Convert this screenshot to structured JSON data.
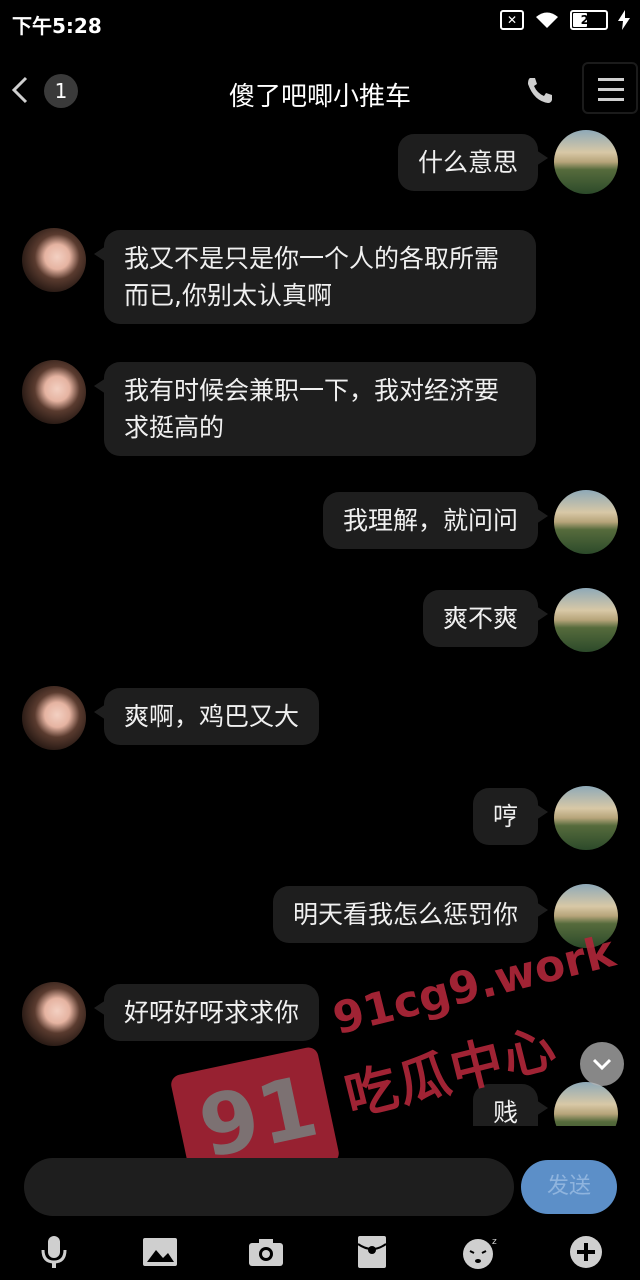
{
  "status_bar": {
    "time": "下午5:28",
    "sim": "✕",
    "battery": "21"
  },
  "header": {
    "badge_count": "1",
    "title": "傻了吧唧小推车"
  },
  "messages": [
    {
      "side": "right",
      "text": "什么意思"
    },
    {
      "side": "left",
      "text": "我又不是只是你一个人的各取所需而已,你别太认真啊"
    },
    {
      "side": "left",
      "text": "我有时候会兼职一下，我对经济要求挺高的"
    },
    {
      "side": "right",
      "text": "我理解，就问问"
    },
    {
      "side": "right",
      "text": "爽不爽"
    },
    {
      "side": "left",
      "text": "爽啊，鸡巴又大"
    },
    {
      "side": "right",
      "text": "哼"
    },
    {
      "side": "right",
      "text": "明天看我怎么惩罚你"
    },
    {
      "side": "left",
      "text": "好呀好呀求求你"
    },
    {
      "side": "right",
      "text": "贱"
    }
  ],
  "watermark": {
    "number": "91",
    "url": "91cg9.work",
    "name": "吃瓜中心"
  },
  "input": {
    "placeholder": "",
    "send_label": "发送"
  },
  "toolbar": [
    "mic-icon",
    "image-icon",
    "camera-icon",
    "red-envelope-icon",
    "emoji-icon",
    "plus-icon"
  ]
}
